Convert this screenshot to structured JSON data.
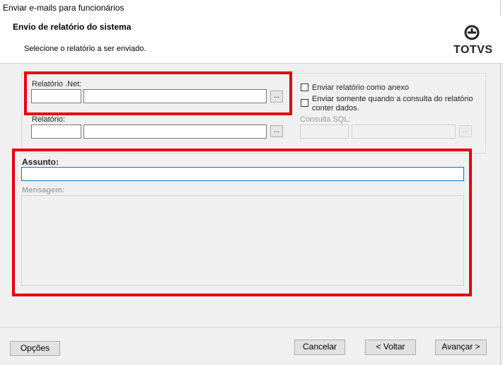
{
  "window": {
    "title": "Enviar e-mails para funcionários"
  },
  "header": {
    "title": "Envio de relatório do sistema",
    "subtitle": "Selecione o relatório a ser enviado.",
    "logo_text": "TOTVS"
  },
  "report_net": {
    "label": "Relatório .Net:",
    "code_value": "",
    "name_value": "",
    "browse_label": "..."
  },
  "report": {
    "label": "Relatório:",
    "code_value": "",
    "name_value": "",
    "browse_label": "..."
  },
  "options": {
    "attach_label": "Enviar relatório como anexo",
    "attach_checked": false,
    "only_with_data_label_line1": "Enviar somente quando a consulta do relatório",
    "only_with_data_label_line2": "conter dados.",
    "only_with_data_checked": false
  },
  "sql_query": {
    "label": "Consulta SQL:",
    "code_value": "",
    "name_value": "",
    "browse_label": "..."
  },
  "subject": {
    "label": "Assunto:",
    "value": ""
  },
  "message": {
    "label": "Mensagem:",
    "value": ""
  },
  "footer": {
    "options_label": "Opções",
    "cancel_label": "Cancelar",
    "back_label": "< Voltar",
    "next_label": "Avançar >"
  },
  "colors": {
    "highlight": "#e8000b",
    "focus": "#0078d7"
  }
}
